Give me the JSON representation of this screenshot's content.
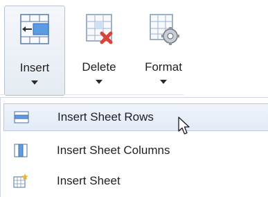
{
  "ribbon": {
    "buttons": [
      {
        "label": "Insert",
        "icon": "insert-cells-icon"
      },
      {
        "label": "Delete",
        "icon": "delete-cells-icon"
      },
      {
        "label": "Format",
        "icon": "format-cells-icon"
      }
    ]
  },
  "menu": {
    "items": [
      {
        "label": "Insert Sheet Rows",
        "icon": "insert-rows-icon",
        "highlighted": true
      },
      {
        "label": "Insert Sheet Columns",
        "icon": "insert-columns-icon",
        "highlighted": false
      },
      {
        "label": "Insert Sheet",
        "icon": "insert-sheet-icon",
        "highlighted": false
      }
    ]
  },
  "colors": {
    "highlight": "#e3ebf7",
    "highlight_border": "#b9c9df",
    "accent_blue": "#3c7fcf",
    "delete_red": "#d9443a"
  }
}
